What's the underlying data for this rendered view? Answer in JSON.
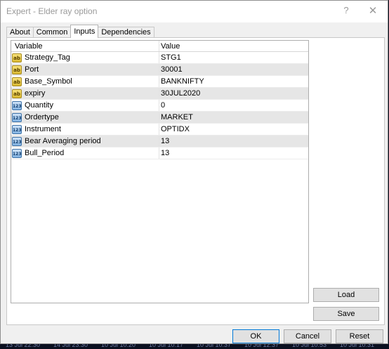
{
  "window": {
    "title": "Expert - Elder ray option",
    "help_glyph": "?",
    "close_glyph": "✕"
  },
  "tabs": [
    {
      "label": "About",
      "active": false
    },
    {
      "label": "Common",
      "active": false
    },
    {
      "label": "Inputs",
      "active": true
    },
    {
      "label": "Dependencies",
      "active": false
    }
  ],
  "grid": {
    "headers": {
      "variable": "Variable",
      "value": "Value"
    },
    "rows": [
      {
        "variable": "Strategy_Tag",
        "value": "STG1",
        "type": "string"
      },
      {
        "variable": "Port",
        "value": "30001",
        "type": "string"
      },
      {
        "variable": "Base_Symbol",
        "value": "BANKNIFTY",
        "type": "string"
      },
      {
        "variable": "expiry",
        "value": "30JUL2020",
        "type": "string"
      },
      {
        "variable": "Quantity",
        "value": "0",
        "type": "number"
      },
      {
        "variable": "Ordertype",
        "value": "MARKET",
        "type": "number"
      },
      {
        "variable": "Instrument",
        "value": "OPTIDX",
        "type": "number"
      },
      {
        "variable": "Bear Averaging period",
        "value": "13",
        "type": "number"
      },
      {
        "variable": "Bull_Period",
        "value": "13",
        "type": "number"
      }
    ],
    "icon_labels": {
      "string": "ab",
      "number": "123"
    }
  },
  "side_buttons": {
    "load": "Load",
    "save": "Save"
  },
  "footer_buttons": {
    "ok": "OK",
    "cancel": "Cancel",
    "reset": "Reset"
  },
  "taskbar_fragments": [
    "13 Jul 22:30",
    "14 Jul 23:30",
    "10 Jul 10:20",
    "10 Jul 10:17",
    "10 Jul 10:37",
    "10 Jul 12:37",
    "10 Jul 10:53",
    "10 Jul 10:31"
  ]
}
